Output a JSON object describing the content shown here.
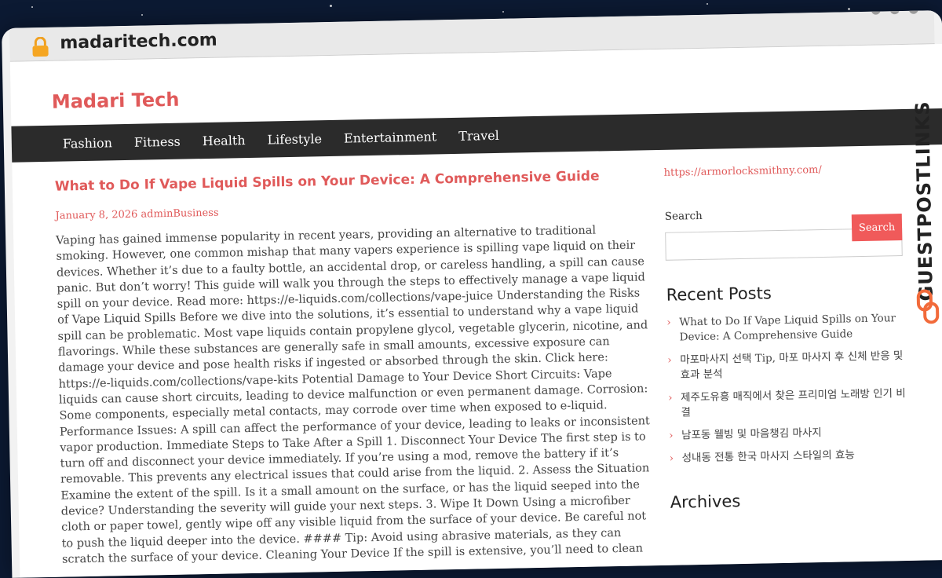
{
  "browser": {
    "url": "madaritech.com"
  },
  "site": {
    "title": "Madari Tech",
    "nav": [
      "Fashion",
      "Fitness",
      "Health",
      "Lifestyle",
      "Entertainment",
      "Travel"
    ]
  },
  "article": {
    "title": "What to Do If Vape Liquid Spills on Your Device: A Comprehensive Guide",
    "meta": "January 8, 2026 adminBusiness",
    "body": "Vaping has gained immense popularity in recent years, providing an alternative to traditional smoking. However, one common mishap that many vapers experience is spilling vape liquid on their devices. Whether it’s due to a faulty bottle, an accidental drop, or careless handling, a spill can cause panic. But don’t worry! This guide will walk you through the steps to effectively manage a vape liquid spill on your device. Read more: https://e-liquids.com/collections/vape-juice Understanding the Risks of Vape Liquid Spills Before we dive into the solutions, it’s essential to understand why a vape liquid spill can be problematic. Most vape liquids contain propylene glycol, vegetable glycerin, nicotine, and flavorings. While these substances are generally safe in small amounts, excessive exposure can damage your device and pose health risks if ingested or absorbed through the skin. Click here: https://e-liquids.com/collections/vape-kits Potential Damage to Your Device Short Circuits: Vape liquids can cause short circuits, leading to device malfunction or even permanent damage. Corrosion: Some components, especially metal contacts, may corrode over time when exposed to e-liquid. Performance Issues: A spill can affect the performance of your device, leading to leaks or inconsistent vapor production. Immediate Steps to Take After a Spill 1. Disconnect Your Device The first step is to turn off and disconnect your device immediately. If you’re using a mod, remove the battery if it’s removable. This prevents any electrical issues that could arise from the liquid. 2. Assess the Situation Examine the extent of the spill. Is it a small amount on the surface, or has the liquid seeped into the device? Understanding the severity will guide your next steps. 3. Wipe It Down Using a microfiber cloth or paper towel, gently wipe off any visible liquid from the surface of your device. Be careful not to push the liquid deeper into the device. #### Tip: Avoid using abrasive materials, as they can scratch the surface of your device. Cleaning Your Device If the spill is extensive, you’ll need to clean"
  },
  "sidebar": {
    "link": "https://armorlocksmithny.com/",
    "search_label": "Search",
    "search_button": "Search",
    "recent_heading": "Recent Posts",
    "recent_posts": [
      "What to Do If Vape Liquid Spills on Your Device: A Comprehensive Guide",
      "마포마사지 선택 Tip, 마포 마사지 후 신체 반응 및 효과 분석",
      "제주도유흥 매직에서 찾은 프리미엄 노래방 인기 비결",
      "남포동 웰빙 및 마음챙김 마사지",
      "성내동 전통 한국 마사지 스타일의 효능"
    ],
    "archives_heading": "Archives"
  },
  "watermark": {
    "text": "GUESTPOSTLINKS"
  },
  "colors": {
    "accent": "#e05a5a",
    "nav_bg": "#2b2b2b",
    "backdrop": "#0c1a33"
  }
}
